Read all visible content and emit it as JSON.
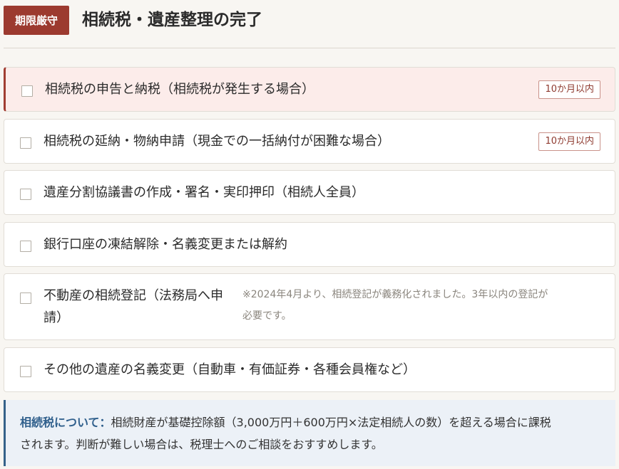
{
  "header": {
    "badge": "期限厳守",
    "title": "相続税・遺産整理の完了"
  },
  "items": [
    {
      "label": "相続税の申告と納税（相続税が発生する場合）",
      "deadline": "10か月以内",
      "checked": false,
      "highlighted": true
    },
    {
      "label": "相続税の延納・物納申請（現金での一括納付が困難な場合）",
      "deadline": "10か月以内",
      "checked": false
    },
    {
      "label": "遺産分割協議書の作成・署名・実印押印（相続人全員）",
      "checked": false
    },
    {
      "label": "銀行口座の凍結解除・名義変更または解約",
      "checked": false
    },
    {
      "label_line1": "不動産の相続登記（法務局へ申",
      "label_line2": "請）",
      "note_line1": "※2024年4月より、相続登記が義務化されました。3年以内の登記が",
      "note_line2": "必要です。",
      "checked": false
    },
    {
      "label": "その他の遺産の名義変更（自動車・有価証券・各種会員権など）",
      "checked": false
    }
  ],
  "info": {
    "lead": "相続税について：",
    "line1": "相続財産が基礎控除額（3,000万円＋600万円×法定相続人の数）を超える場合に課税",
    "line2": "されます。判断が難しい場合は、税理士へのご相談をおすすめします。"
  },
  "colors": {
    "accent_red": "#9c3a2f",
    "alert_bg": "#fcecea",
    "info_bg": "#ecf1f7",
    "info_accent": "#35628a"
  }
}
